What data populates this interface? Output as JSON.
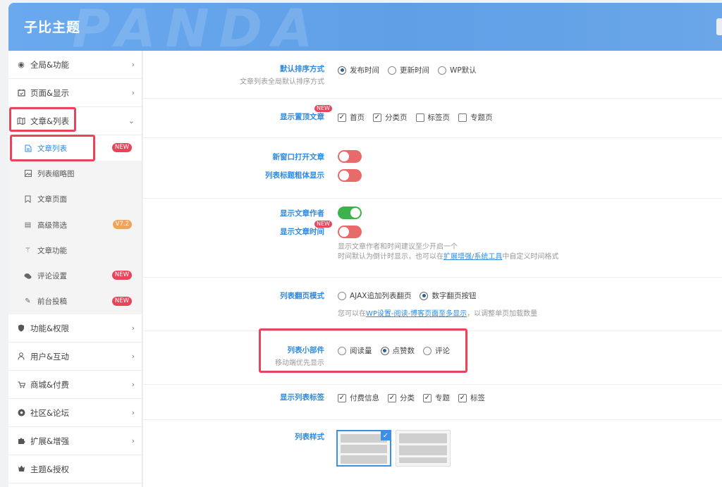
{
  "header": {
    "title": "子比主题",
    "watermark": "PANDA"
  },
  "sidebar": {
    "items": [
      {
        "label": "全局&功能",
        "icon": "settings-icon"
      },
      {
        "label": "页面&显示",
        "icon": "calendar-icon"
      },
      {
        "label": "文章&列表",
        "icon": "map-icon"
      },
      {
        "label": "功能&权限",
        "icon": "shield-icon"
      },
      {
        "label": "用户&互动",
        "icon": "user-icon"
      },
      {
        "label": "商城&付费",
        "icon": "cart-icon"
      },
      {
        "label": "社区&论坛",
        "icon": "community-icon"
      },
      {
        "label": "扩展&增强",
        "icon": "puzzle-icon"
      },
      {
        "label": "主题&授权",
        "icon": "theme-icon"
      }
    ],
    "subitems": [
      {
        "label": "文章列表",
        "badge": "NEW"
      },
      {
        "label": "列表缩略图",
        "badge": ""
      },
      {
        "label": "文章页面",
        "badge": ""
      },
      {
        "label": "高级筛选",
        "badge": "V7.2"
      },
      {
        "label": "文章功能",
        "badge": ""
      },
      {
        "label": "评论设置",
        "badge": "NEW"
      },
      {
        "label": "前台投稿",
        "badge": "NEW"
      }
    ]
  },
  "content": {
    "sort": {
      "label": "默认排序方式",
      "desc": "文章列表全局默认排序方式",
      "options": [
        "发布时间",
        "更新时间",
        "WP默认"
      ],
      "selected": 0
    },
    "sticky": {
      "label": "显示置顶文章",
      "new": "NEW",
      "options": [
        "首页",
        "分类页",
        "标签页",
        "专题页"
      ],
      "checked": [
        true,
        true,
        false,
        false
      ]
    },
    "new_window": {
      "label": "新窗口打开文章",
      "on": false
    },
    "bold_title": {
      "label": "列表标题粗体显示",
      "on": false
    },
    "show_author": {
      "label": "显示文章作者",
      "on": true
    },
    "show_time": {
      "label": "显示文章时间",
      "new": "NEW",
      "on": false
    },
    "time_help_1": "显示文章作者和时间建议至少开启一个",
    "time_help_2_pre": "时间默认为倒计时显示，也可以在",
    "time_help_2_link": "扩展增强/系统工具",
    "time_help_2_post": "中自定义时间格式",
    "paging": {
      "label": "列表翻页模式",
      "options": [
        "AJAX追加列表翻页",
        "数字翻页按钮"
      ],
      "selected": 1,
      "help_pre": "您可以在",
      "help_link": "WP设置-阅读-博客页面至多显示",
      "help_post": "，以调整单页加载数量"
    },
    "widget": {
      "label": "列表小部件",
      "desc": "移动端优先显示",
      "options": [
        "阅读量",
        "点赞数",
        "评论"
      ],
      "selected": 1
    },
    "tags": {
      "label": "显示列表标签",
      "options": [
        "付费信息",
        "分类",
        "专题",
        "标签"
      ],
      "checked": [
        true,
        true,
        true,
        true
      ]
    },
    "style": {
      "label": "列表样式"
    }
  }
}
